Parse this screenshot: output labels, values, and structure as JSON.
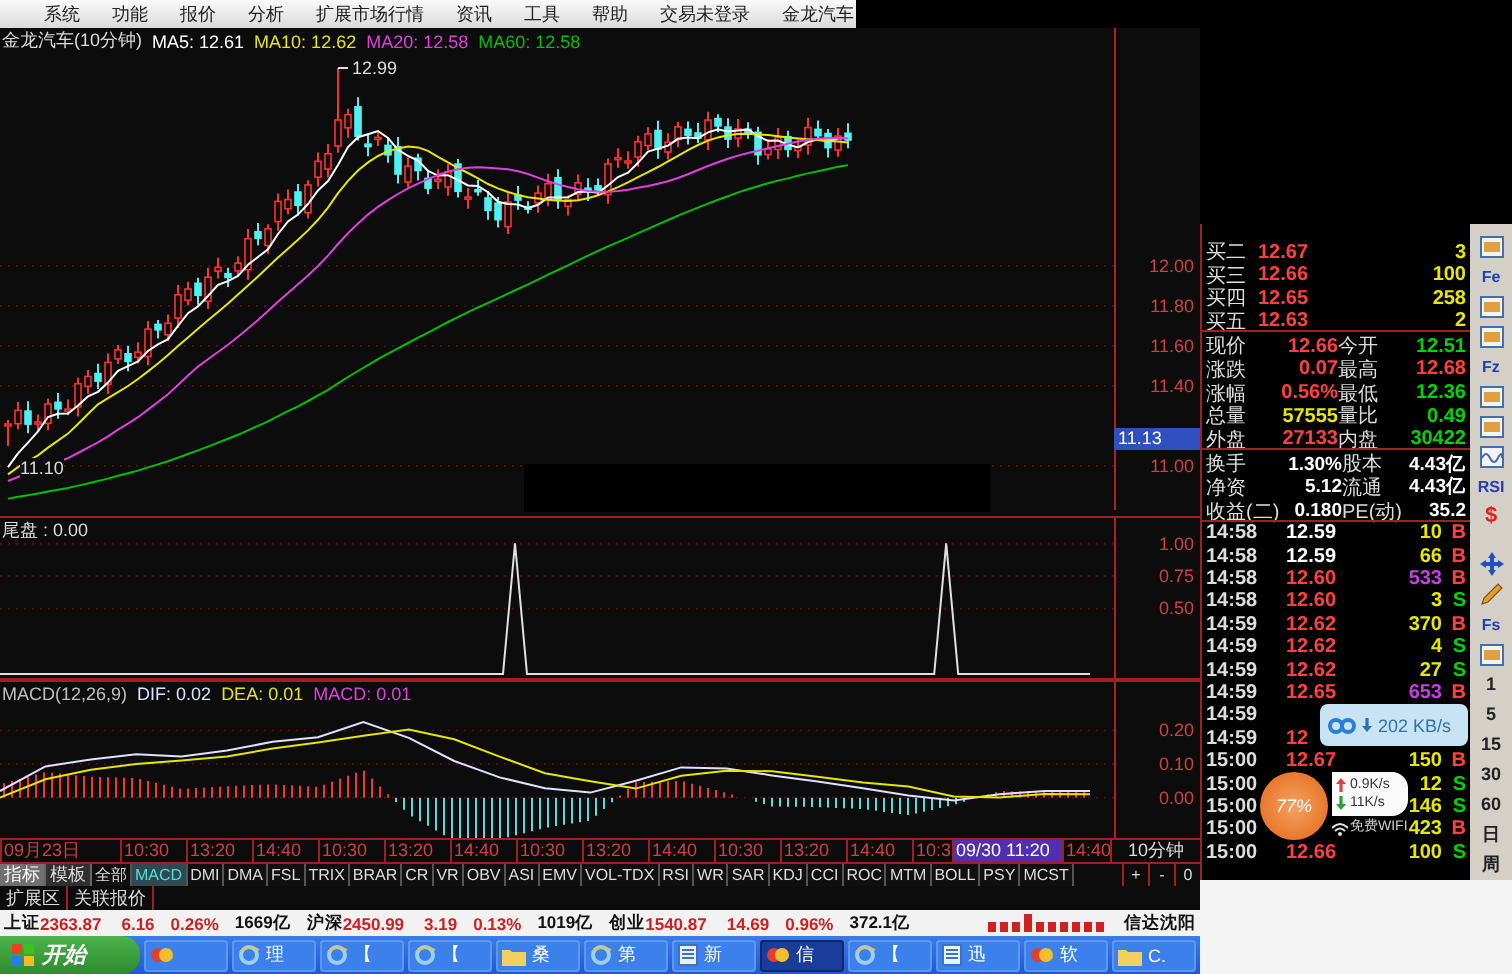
{
  "menu": {
    "items": [
      "系统",
      "功能",
      "报价",
      "分析",
      "扩展市场行情",
      "资讯",
      "工具",
      "帮助"
    ],
    "login": "交易未登录",
    "stock": "金龙汽车"
  },
  "price_chart": {
    "title": "金龙汽车(10分钟)",
    "ma_legend": [
      {
        "label": "MA5: 12.61",
        "color": "#ffffff"
      },
      {
        "label": "MA10: 12.62",
        "color": "#e6e600"
      },
      {
        "label": "MA20: 12.58",
        "color": "#e040e0"
      },
      {
        "label": "MA60: 12.58",
        "color": "#00c000"
      }
    ],
    "high_marker": "12.99",
    "low_marker": "11.10",
    "axis": [
      "12.00",
      "11.80",
      "11.60",
      "11.40",
      "11.00"
    ],
    "cursor_price": "11.13"
  },
  "tail_chart": {
    "value_text": " : 0.00",
    "chart_data": {
      "type": "line",
      "categories": [
        null,
        null,
        null,
        null,
        null,
        null,
        null,
        null,
        null,
        null,
        null,
        null,
        null,
        null,
        null,
        null,
        null,
        null,
        null,
        null,
        null,
        null,
        null,
        null,
        null,
        null,
        null,
        null,
        null,
        null,
        null,
        null,
        null,
        null,
        null,
        null,
        null,
        null,
        null,
        null,
        null,
        null,
        null,
        null,
        null,
        null,
        null,
        null,
        null,
        null,
        null,
        null,
        null,
        null,
        null,
        null,
        null,
        null,
        null,
        null,
        null,
        null,
        null,
        null,
        null,
        null,
        null,
        null,
        null,
        null,
        null,
        null,
        null,
        null,
        null,
        null,
        null,
        null,
        null,
        null,
        null,
        null,
        null,
        null,
        null,
        null,
        null,
        null,
        null,
        null,
        null,
        null
      ],
      "series": [
        {
          "name": "尾盘",
          "color": "#e0e0e0",
          "values": [
            0,
            0,
            0,
            0,
            0,
            0,
            0,
            0,
            0,
            0,
            0,
            0,
            0,
            0,
            0,
            0,
            0,
            0,
            0,
            0,
            0,
            0,
            0,
            0,
            0,
            0,
            0,
            0,
            0,
            0,
            0,
            0,
            0,
            0,
            0,
            0,
            0,
            0,
            0,
            0,
            0,
            0,
            0,
            1,
            0,
            0,
            0,
            0,
            0,
            0,
            0,
            0,
            0,
            0,
            0,
            0,
            0,
            0,
            0,
            0,
            0,
            0,
            0,
            0,
            0,
            0,
            0,
            0,
            0,
            0,
            0,
            0,
            0,
            0,
            0,
            0,
            0,
            0,
            0,
            1,
            0,
            0,
            0,
            0,
            0,
            0,
            0,
            0,
            0,
            0,
            0,
            0
          ]
        }
      ],
      "ylim": [
        -0.03,
        1.21
      ],
      "grid": true,
      "yticks": [
        {
          "value": 0.5,
          "label": "0.50"
        },
        {
          "value": 0.75,
          "label": "0.75"
        },
        {
          "value": 1,
          "label": "1.00"
        }
      ]
    }
  },
  "macd_chart": {
    "title": "MACD(12,26,9)",
    "series_values": [
      ": 0.02",
      ": 0.01"
    ],
    "histogram_label": {
      "label": "MACD: 0.01",
      "color": "#e040e0"
    },
    "chart_data": {
      "type": "line",
      "categories": [
        null,
        null,
        null,
        null,
        null,
        null,
        null,
        null,
        null,
        null,
        null,
        null,
        null,
        null,
        null,
        null,
        null,
        null,
        null,
        null,
        null,
        null,
        null,
        null,
        null
      ],
      "series": [
        {
          "name": "DIF",
          "color": "#e0e0ff",
          "values": [
            0.02,
            0.093,
            0.114,
            0.129,
            0.123,
            0.14,
            0.166,
            0.18,
            0.225,
            0.178,
            0.109,
            0.06,
            0.028,
            0.015,
            0.05,
            0.09,
            0.087,
            0.066,
            0.048,
            0.028,
            0.007,
            -0.008,
            0.01,
            0.02,
            0.02
          ]
        },
        {
          "name": "DEA",
          "color": "#e6e600",
          "values": [
            0,
            0.055,
            0.083,
            0.1,
            0.11,
            0.123,
            0.146,
            0.164,
            0.184,
            0.203,
            0.174,
            0.122,
            0.073,
            0.049,
            0.027,
            0.065,
            0.08,
            0.079,
            0.062,
            0.045,
            0.033,
            0.003,
            0,
            0.011,
            0.01
          ]
        }
      ],
      "ylim": [
        -0.12,
        0.35
      ],
      "grid": true,
      "yticks": [
        {
          "value": 0,
          "label": "0.00"
        },
        {
          "value": 0.1,
          "label": "0.10"
        },
        {
          "value": 0.2,
          "label": "0.20"
        }
      ]
    }
  },
  "time_axis": {
    "labels": [
      {
        "text": "09月23日",
        "selected": false
      },
      {
        "text": "10:30",
        "selected": false
      },
      {
        "text": "13:20",
        "selected": false
      },
      {
        "text": "14:40",
        "selected": false
      },
      {
        "text": "10:30",
        "selected": false
      },
      {
        "text": "13:20",
        "selected": false
      },
      {
        "text": "14:40",
        "selected": false
      },
      {
        "text": "10:30",
        "selected": false
      },
      {
        "text": "13:20",
        "selected": false
      },
      {
        "text": "14:40",
        "selected": false
      },
      {
        "text": "10:30",
        "selected": false
      },
      {
        "text": "13:20",
        "selected": false
      },
      {
        "text": "14:40",
        "selected": false
      },
      {
        "text": "10:3",
        "selected": false
      },
      {
        "text": "09/30 11:20",
        "selected": true
      },
      {
        "text": "14:40",
        "selected": false
      }
    ],
    "period": "10分钟"
  },
  "panel_tabs": [
    {
      "label": "指标",
      "selected": true
    },
    {
      "label": "模板",
      "selected": false
    }
  ],
  "indicator_tabs": [
    {
      "label": "全部",
      "selected": false
    },
    {
      "label": "MACD",
      "selected": true
    },
    {
      "label": "DMI",
      "selected": false
    },
    {
      "label": "DMA",
      "selected": false
    },
    {
      "label": "FSL",
      "selected": false
    },
    {
      "label": "TRIX",
      "selected": false
    },
    {
      "label": "BRAR",
      "selected": false
    },
    {
      "label": "CR",
      "selected": false
    },
    {
      "label": "VR",
      "selected": false
    },
    {
      "label": "OBV",
      "selected": false
    },
    {
      "label": "ASI",
      "selected": false
    },
    {
      "label": "EMV",
      "selected": false
    },
    {
      "label": "VOL-TDX",
      "selected": false
    },
    {
      "label": "RSI",
      "selected": false
    },
    {
      "label": "WR",
      "selected": false
    },
    {
      "label": "SAR",
      "selected": false
    },
    {
      "label": "KDJ",
      "selected": false
    },
    {
      "label": "CCI",
      "selected": false
    },
    {
      "label": "ROC",
      "selected": false
    },
    {
      "label": "MTM",
      "selected": false
    },
    {
      "label": "BOLL",
      "selected": false
    },
    {
      "label": "PSY",
      "selected": false
    },
    {
      "label": "MCST",
      "selected": false
    }
  ],
  "zoom_buttons": [
    "+",
    "-",
    "0"
  ],
  "ext_tabs": [
    "扩展区",
    "关联报价"
  ],
  "status_bar": {
    "indices": [
      {
        "name": "上证",
        "value": "2363.87",
        "change": "6.16",
        "percent": "0.26%",
        "turnover": "1669亿"
      },
      {
        "name": "沪深",
        "value": "2450.99",
        "change": "3.19",
        "percent": "0.13%",
        "turnover": "1019亿"
      },
      {
        "name": "创业",
        "value": "1540.87",
        "change": "14.69",
        "percent": "0.96%",
        "turnover": "372.1亿"
      }
    ],
    "broker": "信达沈阳"
  },
  "taskbar": {
    "start": "开始",
    "items": [
      {
        "kind": "app",
        "selected": false
      },
      {
        "kind": "browser",
        "label": "理",
        "selected": false
      },
      {
        "kind": "browser",
        "label": "【",
        "selected": false
      },
      {
        "kind": "browser",
        "label": "【",
        "selected": false
      },
      {
        "kind": "folder",
        "label": "桑",
        "selected": false
      },
      {
        "kind": "browser",
        "label": "第",
        "selected": false
      },
      {
        "kind": "document",
        "label": "新",
        "selected": false
      },
      {
        "kind": "app",
        "label": "信",
        "selected": true
      },
      {
        "kind": "browser",
        "label": "【",
        "selected": false
      },
      {
        "kind": "document",
        "label": "迅",
        "selected": false
      },
      {
        "kind": "app",
        "label": "软",
        "selected": false
      },
      {
        "kind": "folder",
        "label": "C.",
        "selected": false
      }
    ]
  },
  "quote": {
    "buy_rows": [
      {
        "label": "买二",
        "price": "12.67",
        "volume": "3"
      },
      {
        "label": "买三",
        "price": "12.66",
        "volume": "100"
      },
      {
        "label": "买四",
        "price": "12.65",
        "volume": "258"
      },
      {
        "label": "买五",
        "price": "12.63",
        "volume": "2"
      }
    ],
    "stats": [
      [
        {
          "label": "现价",
          "value": "12.66",
          "color": "#ff4040"
        },
        {
          "label": "今开",
          "value": "12.51",
          "color": "#00d400"
        }
      ],
      [
        {
          "label": "涨跌",
          "value": "0.07",
          "color": "#ff4040"
        },
        {
          "label": "最高",
          "value": "12.68",
          "color": "#ff4040"
        }
      ],
      [
        {
          "label": "涨幅",
          "value": "0.56%",
          "color": "#ff4040"
        },
        {
          "label": "最低",
          "value": "12.36",
          "color": "#00d400"
        }
      ],
      [
        {
          "label": "总量",
          "value": "57555",
          "color": "#e6e600"
        },
        {
          "label": "量比",
          "value": "0.49",
          "color": "#00d400"
        }
      ],
      [
        {
          "label": "外盘",
          "value": "27133",
          "color": "#ff4040"
        },
        {
          "label": "内盘",
          "value": "30422",
          "color": "#00d400"
        }
      ]
    ],
    "info": [
      [
        {
          "label": "换手",
          "value": "1.30%"
        },
        {
          "label": "股本",
          "value": "4.43亿"
        }
      ],
      [
        {
          "label": "净资",
          "value": "5.12"
        },
        {
          "label": "流通",
          "value": "4.43亿"
        }
      ],
      [
        {
          "label": "收益(二)",
          "value": "0.180"
        },
        {
          "label": "PE(动)",
          "value": "35.2"
        }
      ]
    ],
    "ticks": [
      {
        "time": "14:58",
        "price": {
          "text": "12.59",
          "color": "#ffffff"
        },
        "volume": {
          "text": "10",
          "big": false
        },
        "side": {
          "text": "B",
          "color": "#ff4040"
        }
      },
      {
        "time": "14:58",
        "price": {
          "text": "12.59",
          "color": "#ffffff"
        },
        "volume": {
          "text": "66",
          "big": false
        },
        "side": {
          "text": "B",
          "color": "#ff4040"
        }
      },
      {
        "time": "14:58",
        "price": {
          "text": "12.60",
          "color": "#ff4040"
        },
        "volume": {
          "text": "533",
          "big": true
        },
        "side": {
          "text": "B",
          "color": "#ff4040"
        }
      },
      {
        "time": "14:58",
        "price": {
          "text": "12.60",
          "color": "#ff4040"
        },
        "volume": {
          "text": "3",
          "big": false
        },
        "side": {
          "text": "S",
          "color": "#00d400"
        }
      },
      {
        "time": "14:59",
        "price": {
          "text": "12.62",
          "color": "#ff4040"
        },
        "volume": {
          "text": "370",
          "big": false
        },
        "side": {
          "text": "B",
          "color": "#ff4040"
        }
      },
      {
        "time": "14:59",
        "price": {
          "text": "12.62",
          "color": "#ff4040"
        },
        "volume": {
          "text": "4",
          "big": false
        },
        "side": {
          "text": "S",
          "color": "#00d400"
        }
      },
      {
        "time": "14:59",
        "price": {
          "text": "12.62",
          "color": "#ff4040"
        },
        "volume": {
          "text": "27",
          "big": false
        },
        "side": {
          "text": "S",
          "color": "#00d400"
        }
      },
      {
        "time": "14:59",
        "price": {
          "text": "12.65",
          "color": "#ff4040"
        },
        "volume": {
          "text": "653",
          "big": true
        },
        "side": {
          "text": "B",
          "color": "#ff4040"
        }
      },
      {
        "time": "14:59"
      },
      {
        "time": "14:59",
        "price": {
          "text": "12",
          "color": "#ff4040"
        }
      },
      {
        "time": "15:00",
        "price": {
          "text": "12.67",
          "color": "#ff4040"
        },
        "volume": {
          "text": "150",
          "big": false
        },
        "side": {
          "text": "B",
          "color": "#ff4040"
        }
      },
      {
        "time": "15:00",
        "volume": {
          "text": "12",
          "big": false
        },
        "side": {
          "text": "S",
          "color": "#00d400"
        }
      },
      {
        "time": "15:00",
        "volume": {
          "text": "146",
          "big": false
        },
        "side": {
          "text": "S",
          "color": "#00d400"
        }
      },
      {
        "time": "15:00",
        "volume": {
          "text": "423",
          "big": false
        },
        "side": {
          "text": "B",
          "color": "#ff4040"
        }
      },
      {
        "time": "15:00",
        "price": {
          "text": "12.66",
          "color": "#ff4040"
        },
        "volume": {
          "text": "100",
          "big": false
        },
        "side": {
          "text": "S",
          "color": "#00d400"
        }
      }
    ]
  },
  "side_toolbar": {
    "upper": [
      {
        "kind": "window"
      },
      {
        "kind": "text",
        "label": "Fe"
      },
      {
        "kind": "window"
      },
      {
        "kind": "window"
      },
      {
        "kind": "text",
        "label": "Fz"
      },
      {
        "kind": "window"
      },
      {
        "kind": "window"
      },
      {
        "kind": "wave"
      },
      {
        "kind": "text",
        "label": "RSI"
      },
      {
        "kind": "sign",
        "label": "$"
      }
    ],
    "lower": [
      {
        "kind": "move"
      },
      {
        "kind": "pencil"
      },
      {
        "kind": "text",
        "label": "Fs"
      },
      {
        "kind": "window"
      },
      {
        "kind": "period",
        "label": "1"
      },
      {
        "kind": "period",
        "label": "5"
      },
      {
        "kind": "period",
        "label": "15"
      },
      {
        "kind": "period",
        "label": "30"
      },
      {
        "kind": "period",
        "label": "60"
      },
      {
        "kind": "period",
        "label": "日"
      },
      {
        "kind": "period",
        "label": "周"
      }
    ]
  },
  "speed_bubble": {
    "speed": "202 KB/s"
  },
  "net_widget": {
    "percent": "77%",
    "upload": "0.9K/s",
    "download": "11K/s",
    "wifi": "免费WIFI"
  }
}
